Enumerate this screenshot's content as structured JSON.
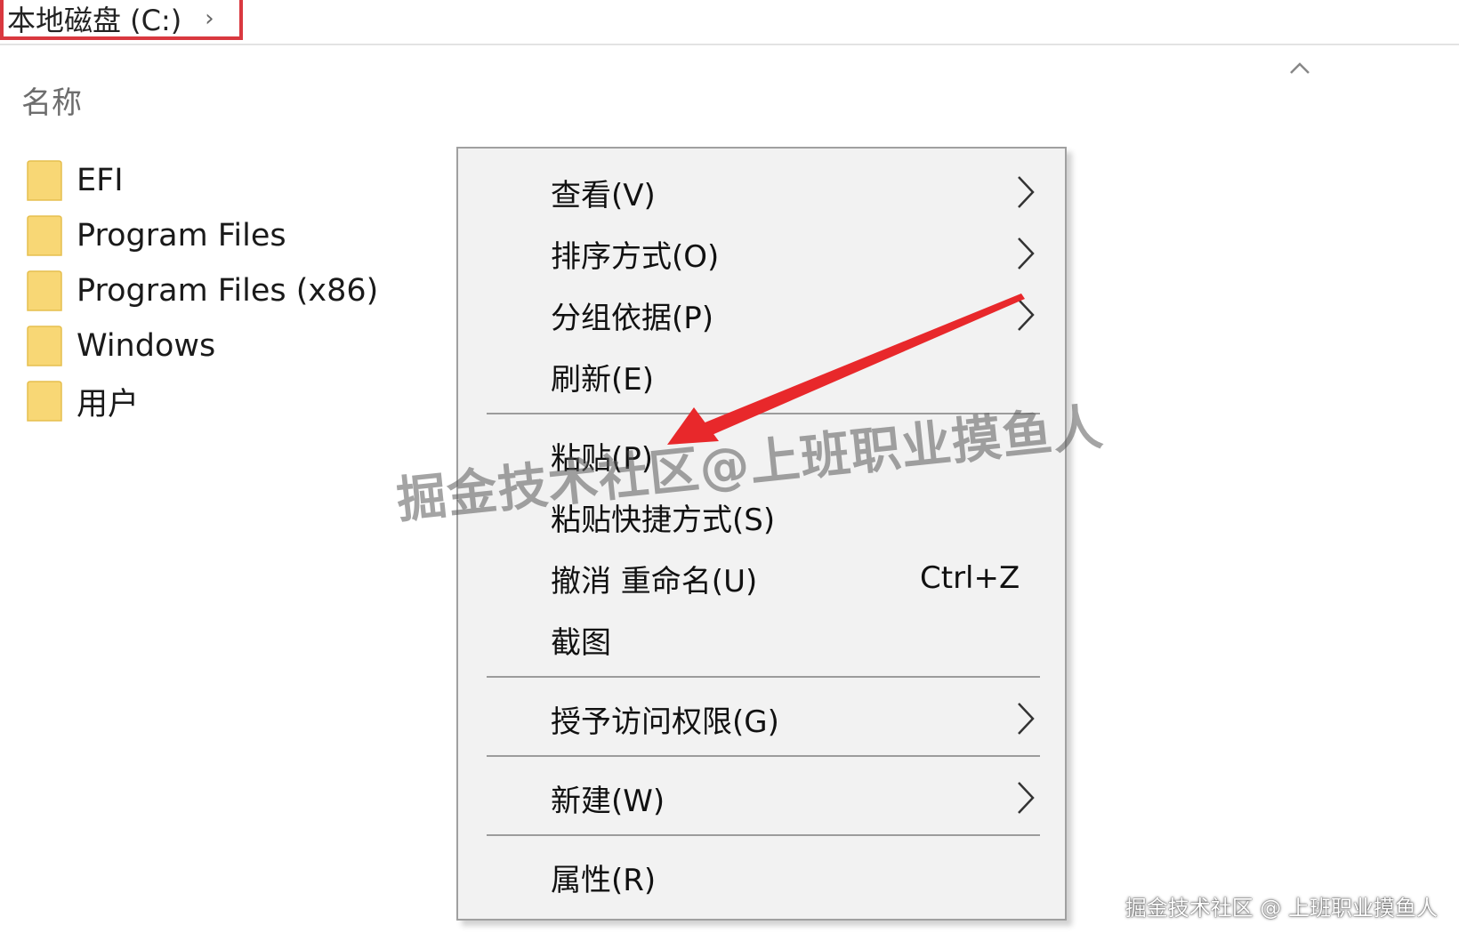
{
  "breadcrumb": {
    "location": "本地磁盘 (C:)",
    "chevron": "›"
  },
  "file_list": {
    "column_header": "名称",
    "items": [
      {
        "name": "EFI",
        "icon": "folder-icon"
      },
      {
        "name": "Program Files",
        "icon": "folder-icon"
      },
      {
        "name": "Program Files (x86)",
        "icon": "folder-icon"
      },
      {
        "name": "Windows",
        "icon": "folder-icon"
      },
      {
        "name": "用户",
        "icon": "folder-icon"
      }
    ]
  },
  "context_menu": {
    "items": [
      {
        "label": "查看(V)",
        "submenu": true
      },
      {
        "label": "排序方式(O)",
        "submenu": true
      },
      {
        "label": "分组依据(P)",
        "submenu": true
      },
      {
        "label": "刷新(E)",
        "submenu": false
      },
      {
        "label": "粘贴(P)",
        "submenu": false
      },
      {
        "label": "粘贴快捷方式(S)",
        "submenu": false
      },
      {
        "label": "撤消 重命名(U)",
        "shortcut": "Ctrl+Z",
        "submenu": false
      },
      {
        "label": "截图",
        "submenu": false
      },
      {
        "label": "授予访问权限(G)",
        "submenu": true
      },
      {
        "label": "新建(W)",
        "submenu": true
      },
      {
        "label": "属性(R)",
        "submenu": false
      }
    ]
  },
  "watermark": {
    "center_text": "掘金技术社区@上班职业摸鱼人",
    "corner_text": "掘金技术社区 @ 上班职业摸鱼人"
  },
  "colors": {
    "highlight_border": "#d9383f",
    "annotation_arrow": "#e8282b",
    "folder_yellow": "#f8d775",
    "menu_background": "#f2f2f2"
  }
}
